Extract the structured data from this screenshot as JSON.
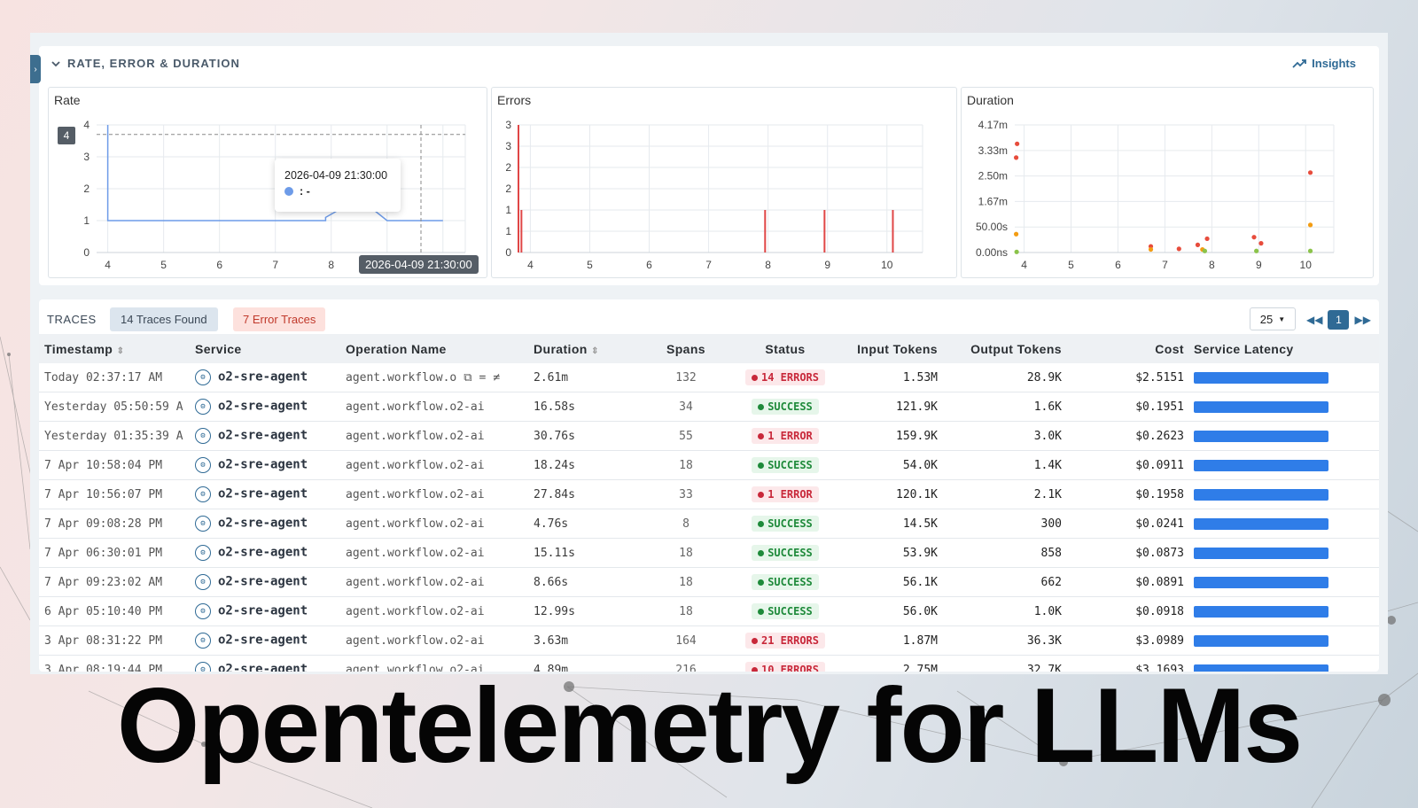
{
  "red": {
    "title": "RATE, ERROR & DURATION",
    "insights_label": "Insights",
    "rate_title": "Rate",
    "errors_title": "Errors",
    "duration_title": "Duration",
    "tooltip_time": "2026-04-09 21:30:00",
    "tooltip_value": ": -",
    "crosshair_time": "2026-04-09 21:30:00",
    "crosshair_y": "4"
  },
  "chart_data": [
    {
      "type": "line",
      "title": "Rate",
      "x_ticks": [
        "4",
        "5",
        "6",
        "7",
        "8",
        "9",
        "10"
      ],
      "y_ticks": [
        "0",
        "1",
        "2",
        "3",
        "4"
      ],
      "series": [
        {
          "x": [
            4.0,
            4.0,
            4.1,
            5,
            6,
            7,
            7.9,
            7.9,
            8.5,
            9.0,
            9.5,
            10.0
          ],
          "values": [
            4,
            1,
            1,
            1,
            1,
            1,
            1,
            1.1,
            1.7,
            1,
            1,
            1
          ]
        }
      ],
      "ylim": [
        0,
        4
      ]
    },
    {
      "type": "bar",
      "title": "Errors",
      "x_ticks": [
        "4",
        "5",
        "6",
        "7",
        "8",
        "9",
        "10"
      ],
      "y_ticks": [
        "0",
        "1",
        "1",
        "2",
        "2",
        "3",
        "3"
      ],
      "x": [
        3.8,
        3.85,
        7.95,
        8.95,
        10.1
      ],
      "values": [
        3,
        1,
        1,
        1,
        1
      ],
      "ylim": [
        0,
        3
      ]
    },
    {
      "type": "scatter",
      "title": "Duration",
      "x_ticks": [
        "4",
        "5",
        "6",
        "7",
        "8",
        "9",
        "10"
      ],
      "y_ticks": [
        "0.00ns",
        "50.00s",
        "1.67m",
        "2.50m",
        "3.33m",
        "4.17m"
      ],
      "points": [
        {
          "x": 3.85,
          "y": 3.55,
          "color": "#e74c3c"
        },
        {
          "x": 3.83,
          "y": 3.1,
          "color": "#e74c3c"
        },
        {
          "x": 3.83,
          "y": 0.6,
          "color": "#f39c12"
        },
        {
          "x": 3.84,
          "y": 0.02,
          "color": "#8bc34a"
        },
        {
          "x": 6.7,
          "y": 0.2,
          "color": "#e74c3c"
        },
        {
          "x": 6.7,
          "y": 0.1,
          "color": "#f39c12"
        },
        {
          "x": 7.3,
          "y": 0.12,
          "color": "#e74c3c"
        },
        {
          "x": 7.7,
          "y": 0.25,
          "color": "#e74c3c"
        },
        {
          "x": 7.8,
          "y": 0.1,
          "color": "#f39c12"
        },
        {
          "x": 7.9,
          "y": 0.45,
          "color": "#e74c3c"
        },
        {
          "x": 7.85,
          "y": 0.05,
          "color": "#8bc34a"
        },
        {
          "x": 8.9,
          "y": 0.5,
          "color": "#e74c3c"
        },
        {
          "x": 9.05,
          "y": 0.3,
          "color": "#e74c3c"
        },
        {
          "x": 8.95,
          "y": 0.05,
          "color": "#8bc34a"
        },
        {
          "x": 10.1,
          "y": 2.61,
          "color": "#e74c3c"
        },
        {
          "x": 10.1,
          "y": 0.9,
          "color": "#f39c12"
        },
        {
          "x": 10.1,
          "y": 0.05,
          "color": "#8bc34a"
        }
      ]
    }
  ],
  "traces": {
    "title": "TRACES",
    "found": "14 Traces Found",
    "errors": "7 Error Traces",
    "page_size": "25",
    "page": "1",
    "columns": [
      "Timestamp",
      "Service",
      "Operation Name",
      "Duration",
      "Spans",
      "Status",
      "Input Tokens",
      "Output Tokens",
      "Cost",
      "Service Latency"
    ],
    "rows": [
      {
        "ts": "Today 02:37:17 AM",
        "svc": "o2-sre-agent",
        "op": "agent.workflow.o",
        "dur": "2.61m",
        "spans": "132",
        "status": "14 ERRORS",
        "ok": false,
        "in": "1.53M",
        "out": "28.9K",
        "cost": "$2.5151"
      },
      {
        "ts": "Yesterday 05:50:59 A",
        "svc": "o2-sre-agent",
        "op": "agent.workflow.o2-ai",
        "dur": "16.58s",
        "spans": "34",
        "status": "SUCCESS",
        "ok": true,
        "in": "121.9K",
        "out": "1.6K",
        "cost": "$0.1951"
      },
      {
        "ts": "Yesterday 01:35:39 A",
        "svc": "o2-sre-agent",
        "op": "agent.workflow.o2-ai",
        "dur": "30.76s",
        "spans": "55",
        "status": "1 ERROR",
        "ok": false,
        "in": "159.9K",
        "out": "3.0K",
        "cost": "$0.2623"
      },
      {
        "ts": "7 Apr 10:58:04 PM",
        "svc": "o2-sre-agent",
        "op": "agent.workflow.o2-ai",
        "dur": "18.24s",
        "spans": "18",
        "status": "SUCCESS",
        "ok": true,
        "in": "54.0K",
        "out": "1.4K",
        "cost": "$0.0911"
      },
      {
        "ts": "7 Apr 10:56:07 PM",
        "svc": "o2-sre-agent",
        "op": "agent.workflow.o2-ai",
        "dur": "27.84s",
        "spans": "33",
        "status": "1 ERROR",
        "ok": false,
        "in": "120.1K",
        "out": "2.1K",
        "cost": "$0.1958"
      },
      {
        "ts": "7 Apr 09:08:28 PM",
        "svc": "o2-sre-agent",
        "op": "agent.workflow.o2-ai",
        "dur": "4.76s",
        "spans": "8",
        "status": "SUCCESS",
        "ok": true,
        "in": "14.5K",
        "out": "300",
        "cost": "$0.0241"
      },
      {
        "ts": "7 Apr 06:30:01 PM",
        "svc": "o2-sre-agent",
        "op": "agent.workflow.o2-ai",
        "dur": "15.11s",
        "spans": "18",
        "status": "SUCCESS",
        "ok": true,
        "in": "53.9K",
        "out": "858",
        "cost": "$0.0873"
      },
      {
        "ts": "7 Apr 09:23:02 AM",
        "svc": "o2-sre-agent",
        "op": "agent.workflow.o2-ai",
        "dur": "8.66s",
        "spans": "18",
        "status": "SUCCESS",
        "ok": true,
        "in": "56.1K",
        "out": "662",
        "cost": "$0.0891"
      },
      {
        "ts": "6 Apr 05:10:40 PM",
        "svc": "o2-sre-agent",
        "op": "agent.workflow.o2-ai",
        "dur": "12.99s",
        "spans": "18",
        "status": "SUCCESS",
        "ok": true,
        "in": "56.0K",
        "out": "1.0K",
        "cost": "$0.0918"
      },
      {
        "ts": "3 Apr 08:31:22 PM",
        "svc": "o2-sre-agent",
        "op": "agent.workflow.o2-ai",
        "dur": "3.63m",
        "spans": "164",
        "status": "21 ERRORS",
        "ok": false,
        "in": "1.87M",
        "out": "36.3K",
        "cost": "$3.0989"
      },
      {
        "ts": "3 Apr 08:19:44 PM",
        "svc": "o2-sre-agent",
        "op": "agent.workflow.o2-ai",
        "dur": "4.89m",
        "spans": "216",
        "status": "10 ERRORS",
        "ok": false,
        "in": "2.75M",
        "out": "32.7K",
        "cost": "$3.1693"
      }
    ]
  },
  "colors": {
    "accent": "#2f6a95",
    "bar": "#2f7de8",
    "error": "#c8283a",
    "success": "#1e8a3a"
  },
  "banner": "Opentelemetry for LLMs"
}
